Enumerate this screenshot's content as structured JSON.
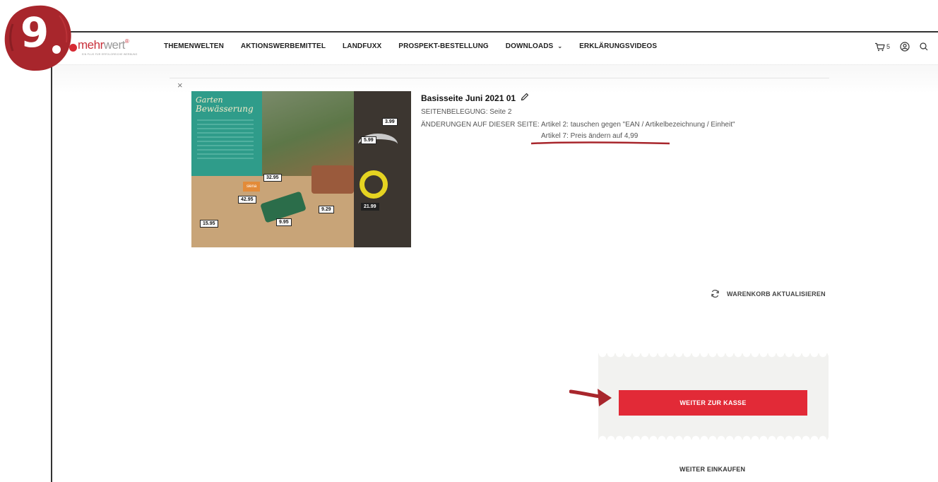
{
  "step_badge": {
    "number": "9"
  },
  "logo": {
    "name_bold": "mehr",
    "name_thin": "wert",
    "reg": "®",
    "tagline": "EIN PLUS FÜR ERFOLGREICHE WERBUNG"
  },
  "nav": {
    "items": [
      "THEMENWELTEN",
      "AKTIONSWERBEMITTEL",
      "LANDFUXX",
      "PROSPEKT-BESTELLUNG",
      "DOWNLOADS",
      "ERKLÄRUNGSVIDEOS"
    ]
  },
  "header": {
    "cart_count": "5"
  },
  "cart_item": {
    "title": "Basisseite Juni 2021 01",
    "seitenbelegung": "SEITENBELEGUNG: Seite 2",
    "aenderungen": "ÄNDERUNGEN AUF DIESER SEITE: Artikel 2: tauschen gegen \"EAN / Artikelbezeichnung / Einheit\"",
    "aenderungen_2": "Artikel 7: Preis ändern auf 4,99",
    "image": {
      "title_line1": "Garten",
      "title_line2": "Bewässerung",
      "prices": [
        "3.99",
        "5.99",
        "32.95",
        "42.95",
        "9.29",
        "21.99",
        "15.95",
        "9.95"
      ],
      "brand_spot": "siena"
    }
  },
  "actions": {
    "refresh_label": "WARENKORB AKTUALISIEREN",
    "checkout_label": "WEITER ZUR KASSE",
    "continue_label": "WEITER EINKAUFEN"
  },
  "colors": {
    "brand_red": "#e22a37",
    "badge_red": "#a8262c"
  }
}
